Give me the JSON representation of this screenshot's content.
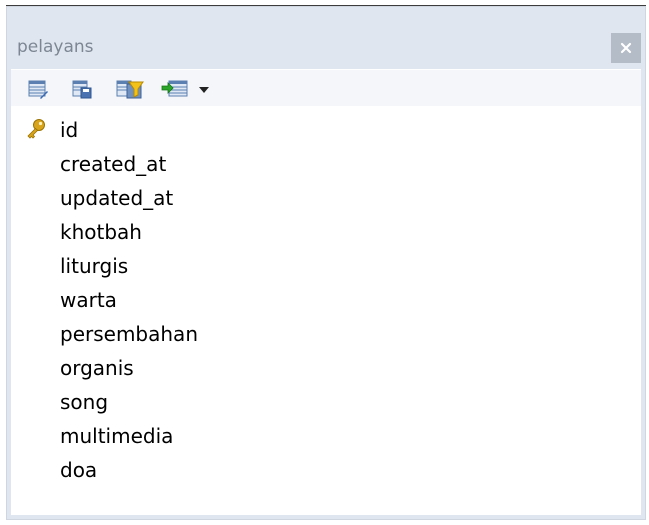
{
  "window": {
    "title": "pelayans",
    "close_glyph": "×"
  },
  "toolbar": {
    "buttons": [
      {
        "icon": "table-edit-icon"
      },
      {
        "icon": "table-save-icon"
      },
      {
        "icon": "table-filter-icon"
      },
      {
        "icon": "table-export-icon"
      },
      {
        "icon": "chevron-down-icon"
      }
    ]
  },
  "fields": {
    "items": [
      {
        "name": "id",
        "primary_key": true
      },
      {
        "name": "created_at"
      },
      {
        "name": "updated_at"
      },
      {
        "name": "khotbah"
      },
      {
        "name": "liturgis"
      },
      {
        "name": "warta"
      },
      {
        "name": "persembahan"
      },
      {
        "name": "organis"
      },
      {
        "name": "song"
      },
      {
        "name": "multimedia"
      },
      {
        "name": "doa"
      }
    ]
  },
  "colors": {
    "panel_bg": "#dfe6ef",
    "title_text": "#7d8794",
    "close_bg": "#b4bcc7",
    "key_gold": "#d8a51a"
  }
}
